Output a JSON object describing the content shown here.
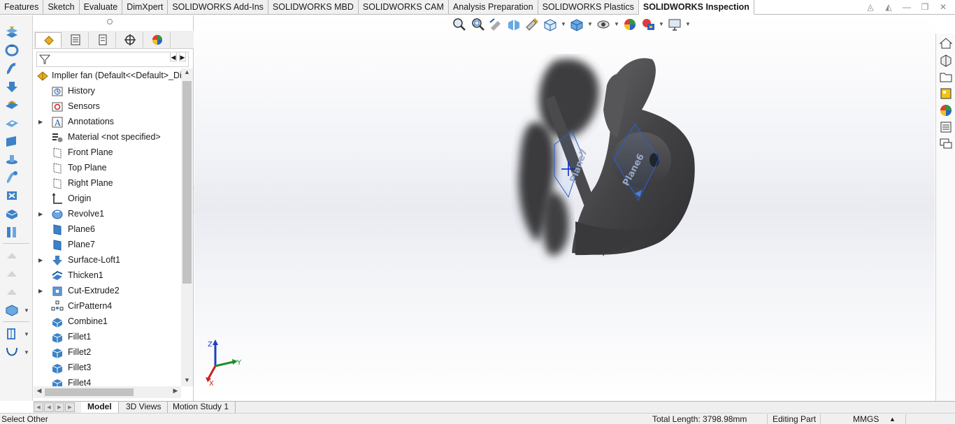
{
  "command_tabs": [
    {
      "label": "Features",
      "active": false
    },
    {
      "label": "Sketch",
      "active": false
    },
    {
      "label": "Evaluate",
      "active": false
    },
    {
      "label": "DimXpert",
      "active": false
    },
    {
      "label": "SOLIDWORKS Add-Ins",
      "active": false
    },
    {
      "label": "SOLIDWORKS MBD",
      "active": false
    },
    {
      "label": "SOLIDWORKS CAM",
      "active": false
    },
    {
      "label": "Analysis Preparation",
      "active": false
    },
    {
      "label": "SOLIDWORKS Plastics",
      "active": false
    },
    {
      "label": "SOLIDWORKS Inspection",
      "active": true
    }
  ],
  "feature_tree": {
    "root": {
      "label": "Impller fan  (Default<<Default>_Di",
      "icon": "part-icon"
    },
    "items": [
      {
        "label": "History",
        "icon": "history-icon",
        "expandable": false
      },
      {
        "label": "Sensors",
        "icon": "sensors-icon",
        "expandable": false
      },
      {
        "label": "Annotations",
        "icon": "annotations-icon",
        "expandable": true
      },
      {
        "label": "Material <not specified>",
        "icon": "material-icon",
        "expandable": false
      },
      {
        "label": "Front Plane",
        "icon": "plane-icon",
        "expandable": false
      },
      {
        "label": "Top Plane",
        "icon": "plane-icon",
        "expandable": false
      },
      {
        "label": "Right Plane",
        "icon": "plane-icon",
        "expandable": false
      },
      {
        "label": "Origin",
        "icon": "origin-icon",
        "expandable": false
      },
      {
        "label": "Revolve1",
        "icon": "revolve-icon",
        "expandable": true
      },
      {
        "label": "Plane6",
        "icon": "plane-solid-icon",
        "expandable": false
      },
      {
        "label": "Plane7",
        "icon": "plane-solid-icon",
        "expandable": false
      },
      {
        "label": "Surface-Loft1",
        "icon": "loft-icon",
        "expandable": true
      },
      {
        "label": "Thicken1",
        "icon": "thicken-icon",
        "expandable": false
      },
      {
        "label": "Cut-Extrude2",
        "icon": "cut-extrude-icon",
        "expandable": true
      },
      {
        "label": "CirPattern4",
        "icon": "circular-pattern-icon",
        "expandable": false
      },
      {
        "label": "Combine1",
        "icon": "combine-icon",
        "expandable": false
      },
      {
        "label": "Fillet1",
        "icon": "fillet-icon",
        "expandable": false
      },
      {
        "label": "Fillet2",
        "icon": "fillet-icon",
        "expandable": false
      },
      {
        "label": "Fillet3",
        "icon": "fillet-icon",
        "expandable": false
      },
      {
        "label": "Fillet4",
        "icon": "fillet-icon",
        "expandable": false
      }
    ]
  },
  "bottom_tabs": [
    {
      "label": "Model",
      "active": true
    },
    {
      "label": "3D Views",
      "active": false
    },
    {
      "label": "Motion Study 1",
      "active": false
    }
  ],
  "viewport": {
    "plane_labels": [
      "Plane7",
      "Plane6"
    ],
    "triad": {
      "x": "X",
      "y": "Y",
      "z": "Z"
    }
  },
  "status": {
    "hint": "Select Other",
    "total_length": "Total Length: 3798.98mm",
    "mode": "Editing Part",
    "units": "MMGS",
    "units_arrow": "▲"
  },
  "colors": {
    "accent_blue": "#1f5fa8",
    "feature_blue": "#3c82c8",
    "model_gray": "#4a4a4d"
  }
}
